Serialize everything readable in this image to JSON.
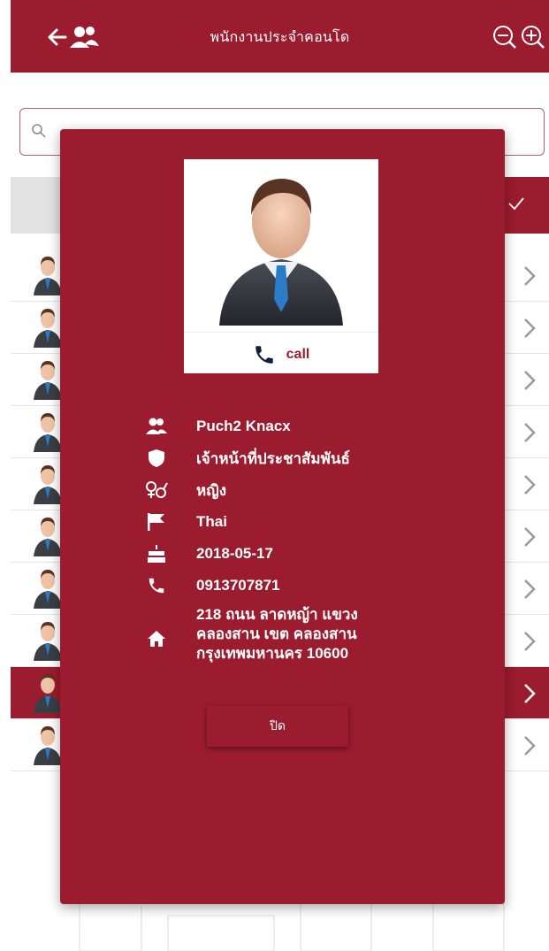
{
  "header": {
    "title": "พนักงานประจำคอนโด",
    "back_icon": "back-arrow-icon",
    "people_icon": "people-icon",
    "zoom_out_icon": "zoom-out-icon",
    "zoom_in_icon": "zoom-in-icon"
  },
  "search": {
    "placeholder": ""
  },
  "list": {
    "row_count": 10,
    "selected_index": 8,
    "avatar_icon": "person-avatar-icon",
    "chevron_icon": "chevron-right-icon"
  },
  "modal": {
    "call_label": "call",
    "name": "Puch2 Knacx",
    "position": "เจ้าหน้าที่ประชาสัมพันธ์",
    "gender": "หญิง",
    "nationality": "Thai",
    "birthdate": "2018-05-17",
    "phone": "0913707871",
    "address": "218 ถนน ลาดหญ้า แขวง\nคลองสาน เขต คลองสาน\nกรุงเทพมหานคร 10600",
    "close_label": "ปิด"
  },
  "colors": {
    "primary": "#9b1c2e",
    "accent_gray": "#e3e3e3"
  }
}
